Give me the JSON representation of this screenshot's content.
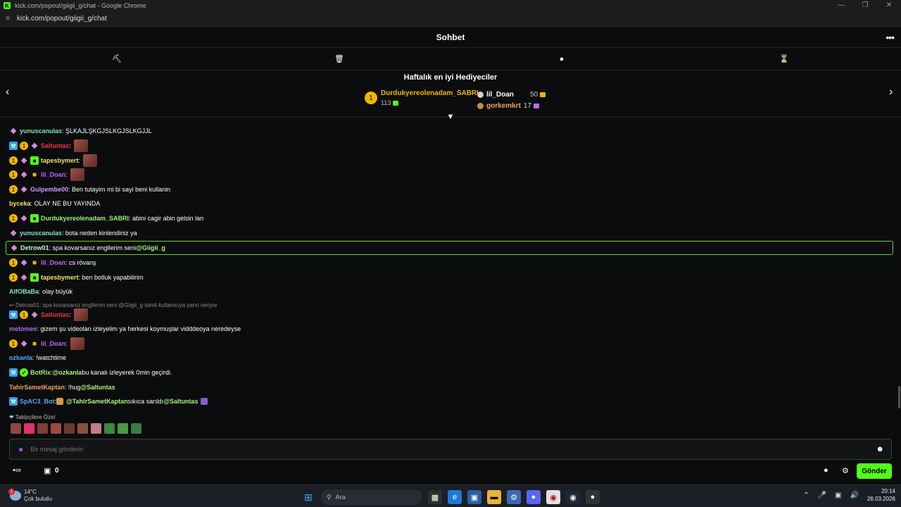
{
  "browser": {
    "window_title": "kick.com/popout/giigii_g/chat - Google Chrome",
    "url": "kick.com/popout/giigii_g/chat"
  },
  "header": {
    "title": "Sohbet"
  },
  "top_gifters": {
    "title": "Haftalık en iyi Hediyeciler",
    "first": {
      "rank": "1",
      "name": "Durdukyereolenadam_SABRI",
      "count": "113"
    },
    "second": {
      "name": "lil_Doan",
      "count": "50"
    },
    "third": {
      "name": "gorkemkrt",
      "count": "17"
    }
  },
  "messages": [
    {
      "user": "yunuscanulas",
      "color": "#7fe6c9",
      "text": ": ŞLKAJLŞKGJSLKGJSLKGJJL"
    },
    {
      "user": "Saltuntas",
      "color": "#e8364a",
      "text": ":"
    },
    {
      "user": "tapesbymert",
      "color": "#f4e36b",
      "text": ":"
    },
    {
      "user": "lil_Doan",
      "color": "#b96af0",
      "text": ":"
    },
    {
      "user": "Gulpembe00",
      "color": "#c9a0f5",
      "text": ": Ben tutayim mi bi sayi beni kullanin"
    },
    {
      "user": "byceka",
      "color": "#f4e36b",
      "text": ": OLAY NE BU YAYINDA"
    },
    {
      "user": "Durdukyereolenadam_SABRI",
      "color": "#9ef07a",
      "text": ": abini cagir abin gelsin lan"
    },
    {
      "user": "yunuscanulas",
      "color": "#7fe6c9",
      "text": ": bota neden kinlendiniz ya"
    },
    {
      "user": "Detrow01",
      "color": "#c5f5c7",
      "text": ": spa kovarsanız engllerim seni ",
      "mention": "@Giigii_g"
    },
    {
      "user": "lil_Doan",
      "color": "#b96af0",
      "text": ": cs rövanş"
    },
    {
      "user": "tapesbymert",
      "color": "#f4e36b",
      "text": ": ben botluk yapabilirim"
    },
    {
      "user": "AlfOBaBa",
      "color": "#7fe6c9",
      "text": ": olay büyük"
    },
    {
      "user": "Saltuntas",
      "color": "#e8364a",
      "text": ":"
    },
    {
      "user": "metomee",
      "color": "#b96af0",
      "text": ": gizem şu videoları izleyelim ya herkesi koymuşlar vidddeoya neredeyse"
    },
    {
      "user": "lil_Doan",
      "color": "#b96af0",
      "text": ":"
    },
    {
      "user": "ozkanla",
      "color": "#5aa8f0",
      "text": ": !watchtime"
    },
    {
      "user": "BotRix",
      "color": "#9ef07a",
      "text": ": ",
      "mention": "@ozkanla",
      "tail": " bu kanalı izleyerek 0min geçirdi."
    },
    {
      "user": "TahirSametKaptan",
      "color": "#f0a35a",
      "text": ": !hug ",
      "mention": "@Saltuntas"
    },
    {
      "user": "SpAC3_Bot",
      "color": "#5aa8f0",
      "text": ": ",
      "mention": "@TahirSametKaptan",
      "tail": " sıkıca sarıldı ",
      "mention2": "@Saltuntas"
    }
  ],
  "reply_context": "Detrow01: spa kovarsanız engllerim seni @Giigii_g isimli kullanıcıya yanıt veriyor",
  "subscriber_emotes_label": "Takipçilere Özel",
  "input": {
    "placeholder": "Bir mesaj gönderin"
  },
  "footer": {
    "points": "0",
    "send_label": "Gönder"
  },
  "taskbar": {
    "weather_temp": "14°C",
    "weather_desc": "Çok bulutlu",
    "weather_badge": "1",
    "search_label": "Ara",
    "time": "20:14",
    "date": "26.03.2026"
  },
  "colors": {
    "accent": "#53fc18",
    "background": "#0b0c0d"
  }
}
